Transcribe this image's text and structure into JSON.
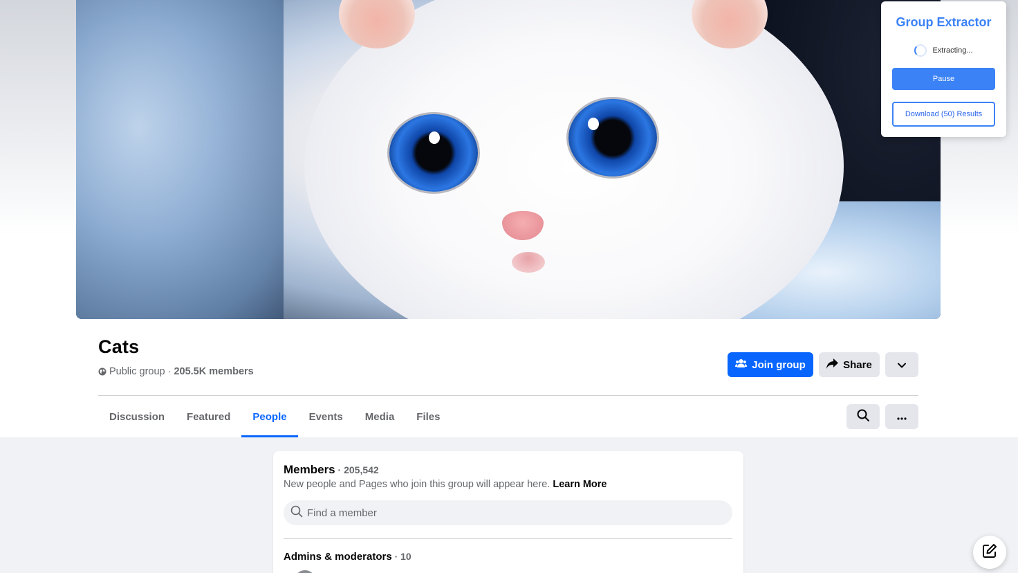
{
  "group": {
    "name": "Cats",
    "privacy": "Public group",
    "separator": " · ",
    "members_short": "205.5K members"
  },
  "actions": {
    "join_label": "Join group",
    "share_label": "Share"
  },
  "tabs": [
    {
      "label": "Discussion",
      "active": false
    },
    {
      "label": "Featured",
      "active": false
    },
    {
      "label": "People",
      "active": true
    },
    {
      "label": "Events",
      "active": false
    },
    {
      "label": "Media",
      "active": false
    },
    {
      "label": "Files",
      "active": false
    }
  ],
  "members_card": {
    "title": "Members",
    "count": " · 205,542",
    "description": "New people and Pages who join this group will appear here.",
    "learn_more": "Learn More",
    "search_placeholder": "Find a member",
    "admins_label": "Admins & moderators",
    "admins_count": " · 10"
  },
  "extension": {
    "title": "Group Extractor",
    "status": "Extracting...",
    "pause_label": "Pause",
    "download_label": "Download (50) Results"
  },
  "colors": {
    "accent": "#0866ff",
    "extension_accent": "#3b82f6"
  },
  "icons": {
    "globe": "globe-icon",
    "join": "people-icon",
    "share": "share-arrow-icon",
    "dropdown": "chevron-down-icon",
    "search": "search-icon",
    "more": "more-dots-icon",
    "compose": "compose-icon"
  }
}
